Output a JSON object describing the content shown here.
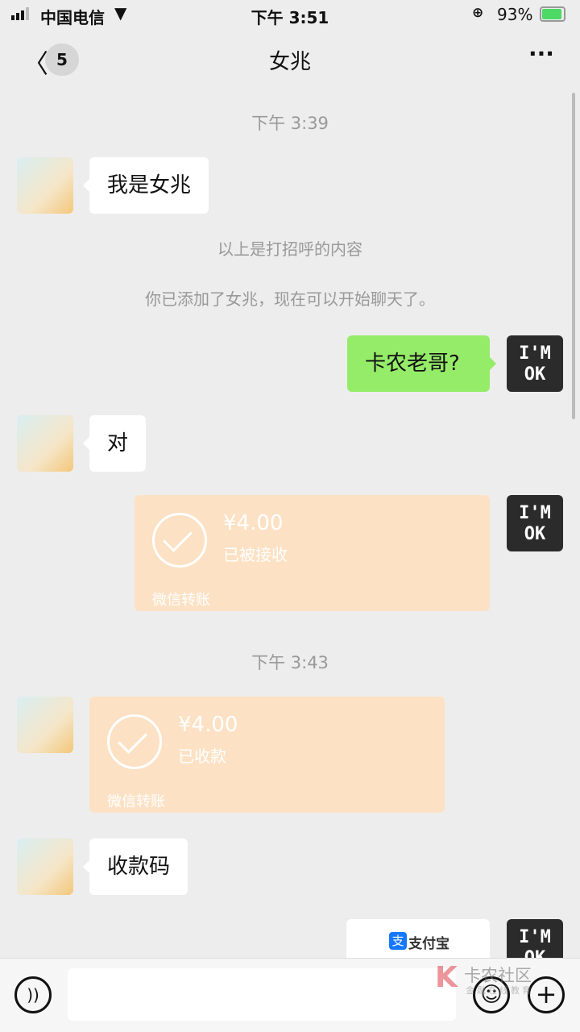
{
  "status": {
    "carrier": "中国电信",
    "time": "下午 3:51",
    "battery": "93%"
  },
  "nav": {
    "unread": "5",
    "title": "女兆"
  },
  "messages": {
    "t1": "下午 3:39",
    "m1": "我是女兆",
    "sys1": "以上是打招呼的内容",
    "sys2": "你已添加了女兆，现在可以开始聊天了。",
    "m2": "卡农老哥?",
    "m3": "对",
    "transfer1": {
      "amount": "¥4.00",
      "status": "已被接收",
      "footer": "微信转账"
    },
    "t2": "下午 3:43",
    "transfer2": {
      "amount": "¥4.00",
      "status": "已收款",
      "footer": "微信转账"
    },
    "m4": "收款码",
    "alipay": "支付宝"
  },
  "avatar_right_text": "I'M OK",
  "watermark": {
    "title": "卡农社区",
    "subtitle": "金融在线教育"
  },
  "colors": {
    "bg": "#ededed",
    "green": "#95ec69",
    "transfer": "#fce1c4"
  }
}
